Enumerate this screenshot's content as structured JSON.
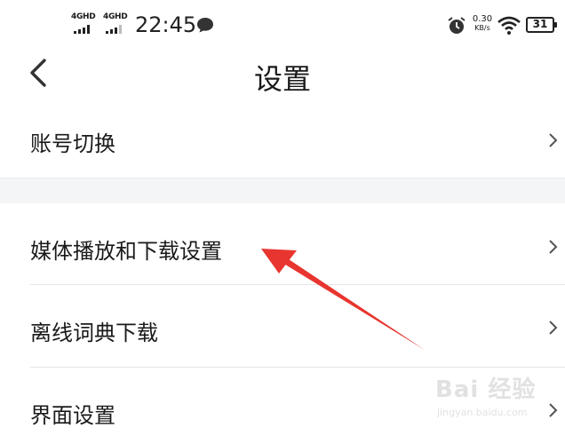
{
  "status_bar": {
    "signal_1": "4GHD",
    "signal_2": "4GHD",
    "time": "22:45",
    "net_speed_value": "0.30",
    "net_speed_unit": "KB/s",
    "battery": "31"
  },
  "header": {
    "back_icon": "chevron-left-icon",
    "title": "设置"
  },
  "settings": {
    "items": [
      {
        "label": "账号切换",
        "icon": "chevron-right-icon"
      },
      {
        "label": "媒体播放和下载设置",
        "icon": "chevron-right-icon"
      },
      {
        "label": "离线词典下载",
        "icon": "chevron-right-icon"
      },
      {
        "label": "界面设置",
        "icon": "chevron-right-icon"
      }
    ]
  },
  "annotation": {
    "arrow_color": "#e8352f"
  },
  "watermark": {
    "brand": "Bai 经验",
    "url": "jingyan.baidu.com"
  }
}
